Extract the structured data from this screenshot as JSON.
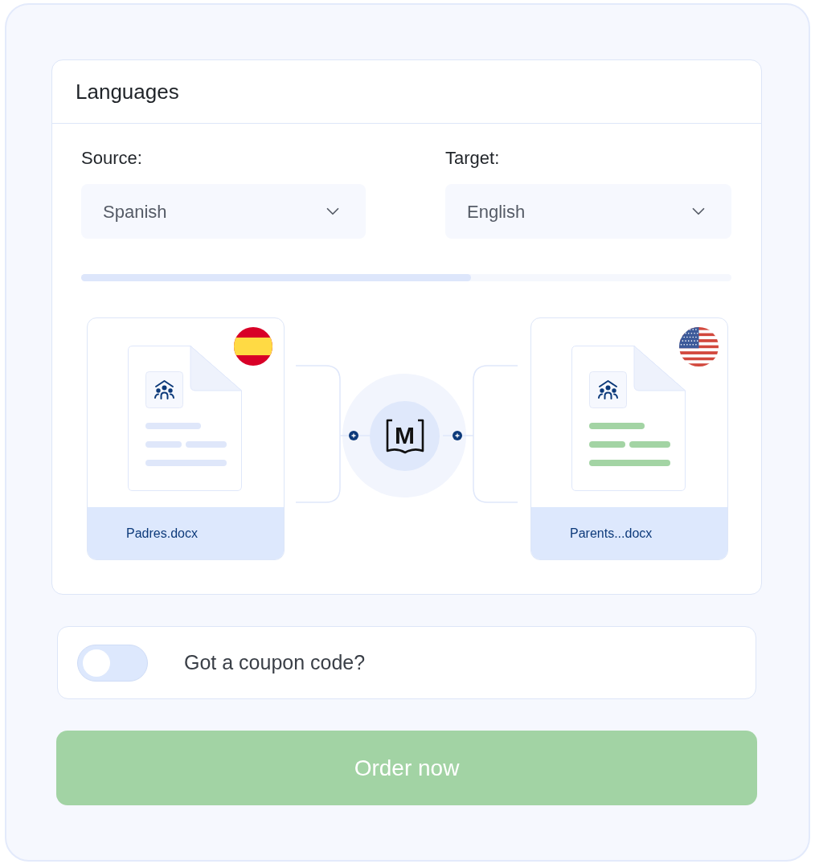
{
  "panel": {
    "title": "Languages"
  },
  "selects": [
    {
      "label": "Source:",
      "value": "Spanish"
    },
    {
      "label": "Target:",
      "value": "English"
    }
  ],
  "progress": {
    "level": 0.6
  },
  "files": [
    {
      "kind": "source",
      "name": "Padres.docx"
    },
    {
      "kind": "target",
      "name": "Parents...docx"
    }
  ],
  "translator": {
    "logo_letter": "M"
  },
  "coupon": {
    "label": "Got a coupon code?",
    "on": false
  },
  "order_button": {
    "label": "Order now",
    "disabled": true
  }
}
